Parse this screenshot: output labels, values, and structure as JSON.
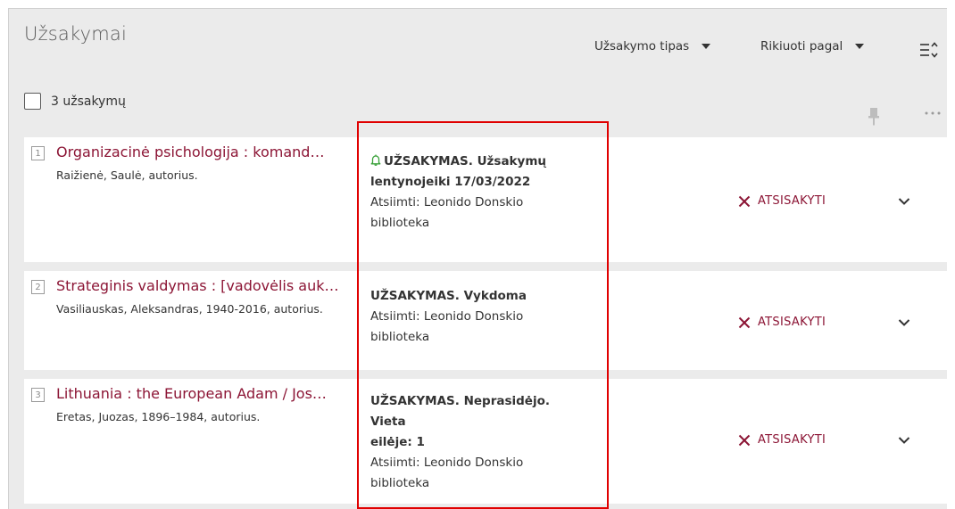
{
  "header": {
    "title": "Užsakymai",
    "type_dropdown_label": "Užsakymo tipas",
    "sort_dropdown_label": "Rikiuoti pagal"
  },
  "toolbar": {
    "count_label": "3 užsakymų"
  },
  "items": [
    {
      "index": "1",
      "title": "Organizacinė psichologija : komand…",
      "author": "Raižienė, Saulė, autorius.",
      "status_line1": "UŽSAKYMAS. Užsakymų",
      "status_line2": "lentynojeiki 17/03/2022",
      "pickup_line1": "Atsiimti: Leonido Donskio",
      "pickup_line2": "biblioteka",
      "cancel_label": "ATSISAKYTI"
    },
    {
      "index": "2",
      "title": "Strateginis valdymas : [vadovėlis auk…",
      "author": "Vasiliauskas, Aleksandras, 1940-2016, autorius.",
      "status_line1": "UŽSAKYMAS. Vykdoma",
      "pickup_line1": "Atsiimti: Leonido Donskio",
      "pickup_line2": "biblioteka",
      "cancel_label": "ATSISAKYTI"
    },
    {
      "index": "3",
      "title": "Lithuania : the European Adam / Jos…",
      "author": "Eretas, Juozas, 1896–1984, autorius.",
      "status_line1": "UŽSAKYMAS. Neprasidėjo. Vieta",
      "status_line2": "eilėje: 1",
      "pickup_line1": "Atsiimti: Leonido Donskio",
      "pickup_line2": "biblioteka",
      "cancel_label": "ATSISAKYTI"
    }
  ],
  "icons": {
    "filter": "sort-filter-icon",
    "pin": "pin-icon",
    "more": "more-icon",
    "bell": "bell-icon",
    "cancel": "close-icon",
    "expand": "chevron-down-icon"
  },
  "colors": {
    "accent": "#8c1535",
    "bell": "#3aa13a",
    "highlight_box": "#e00000",
    "panel_bg": "#ebebeb"
  }
}
